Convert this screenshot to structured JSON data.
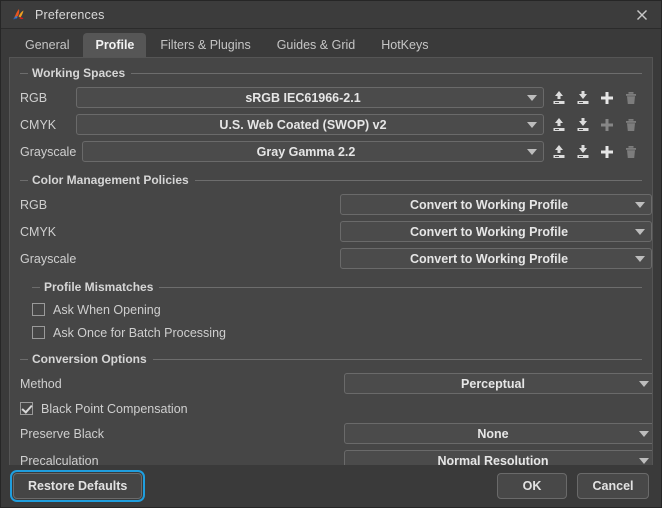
{
  "window": {
    "title": "Preferences",
    "app_icon": "krita-app-icon",
    "close_icon": "close-icon"
  },
  "tabs": [
    {
      "label": "General",
      "active": false
    },
    {
      "label": "Profile",
      "active": true
    },
    {
      "label": "Filters & Plugins",
      "active": false
    },
    {
      "label": "Guides & Grid",
      "active": false
    },
    {
      "label": "HotKeys",
      "active": false
    }
  ],
  "working_spaces": {
    "title": "Working Spaces",
    "rows": [
      {
        "label": "RGB",
        "value": "sRGB IEC61966-2.1",
        "import_enabled": true,
        "export_enabled": true,
        "add_enabled": true,
        "delete_enabled": false
      },
      {
        "label": "CMYK",
        "value": "U.S. Web Coated (SWOP) v2",
        "import_enabled": true,
        "export_enabled": true,
        "add_enabled": false,
        "delete_enabled": false
      },
      {
        "label": "Grayscale",
        "value": "Gray Gamma 2.2",
        "import_enabled": true,
        "export_enabled": true,
        "add_enabled": true,
        "delete_enabled": false
      }
    ],
    "icons": {
      "import": "import-profile-icon",
      "export": "export-profile-icon",
      "add": "add-profile-icon",
      "delete": "delete-profile-icon"
    }
  },
  "color_management_policies": {
    "title": "Color Management Policies",
    "rows": [
      {
        "label": "RGB",
        "value": "Convert to Working Profile"
      },
      {
        "label": "CMYK",
        "value": "Convert to Working Profile"
      },
      {
        "label": "Grayscale",
        "value": "Convert to Working Profile"
      }
    ]
  },
  "profile_mismatches": {
    "title": "Profile Mismatches",
    "checkboxes": [
      {
        "label": "Ask When Opening",
        "checked": false
      },
      {
        "label": "Ask Once for Batch Processing",
        "checked": false
      }
    ]
  },
  "conversion_options": {
    "title": "Conversion Options",
    "method": {
      "label": "Method",
      "value": "Perceptual"
    },
    "black_point": {
      "label": "Black Point Compensation",
      "checked": true
    },
    "preserve_black": {
      "label": "Preserve Black",
      "value": "None"
    },
    "precalculation": {
      "label": "Precalculation",
      "value": "Normal Resolution"
    }
  },
  "footer": {
    "restore_defaults": "Restore Defaults",
    "ok": "OK",
    "cancel": "Cancel"
  },
  "colors": {
    "window_bg": "#3a3a3a",
    "panel_bg": "#464646",
    "accent_focus": "#1f9ede",
    "text": "#d9d9d9",
    "combo_bg": "#4b4b4b"
  }
}
